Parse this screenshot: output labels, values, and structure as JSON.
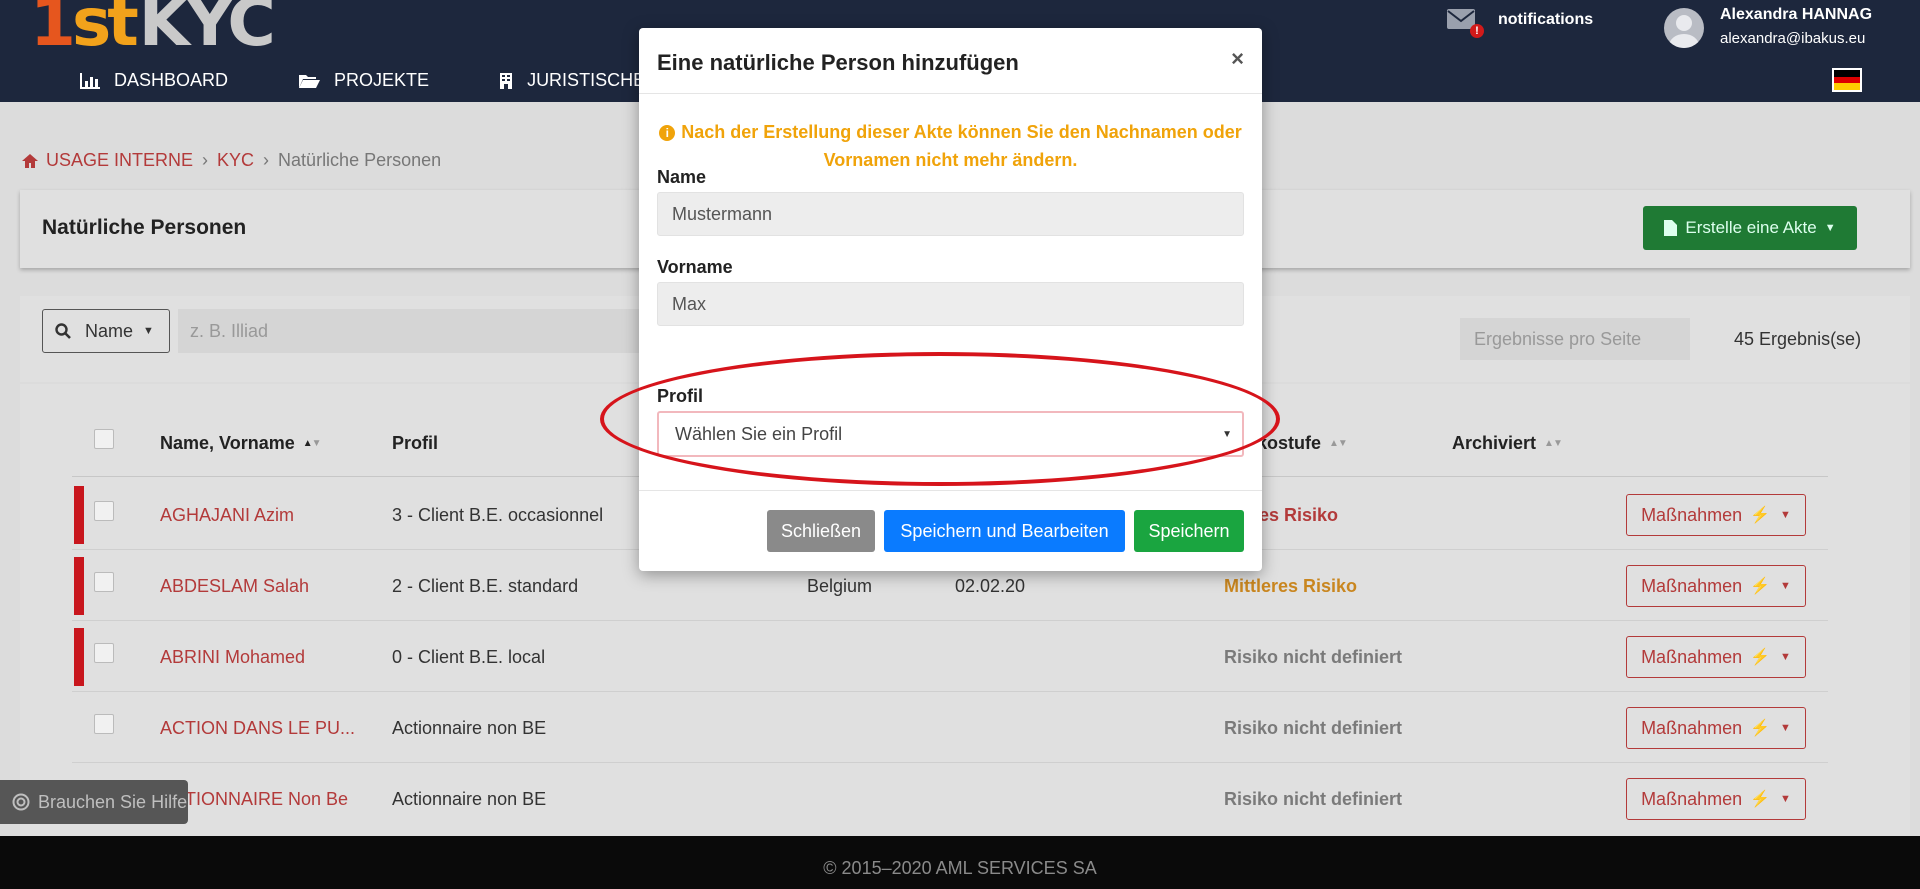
{
  "header": {
    "logo": {
      "num": "1",
      "st": "st",
      "kyc": "KYC"
    },
    "notifications_label": "notifications",
    "notification_badge": "!",
    "user": {
      "name": "Alexandra HANNAG",
      "email": "alexandra@ibakus.eu"
    },
    "nav": [
      {
        "label": "DASHBOARD",
        "icon": "bar-chart-icon"
      },
      {
        "label": "PROJEKTE",
        "icon": "folder-open-icon"
      },
      {
        "label": "JURISTISCHE PERSONEN",
        "icon": "building-icon"
      }
    ],
    "language_flag_colors": [
      "#000000",
      "#dd0000",
      "#ffce00"
    ]
  },
  "breadcrumb": {
    "home": "USAGE INTERNE",
    "kyc": "KYC",
    "current": "Natürliche Personen"
  },
  "page": {
    "title": "Natürliche Personen",
    "create_button": "Erstelle eine Akte"
  },
  "filters": {
    "field_select": "Name",
    "search_placeholder": "z. B. Illiad",
    "per_page_placeholder": "Ergebnisse pro Seite",
    "results_count": "45 Ergebnis(se)"
  },
  "table": {
    "columns": {
      "name": "Name, Vorname",
      "profile": "Profil",
      "risk": "Risikostufe",
      "archived": "Archiviert"
    },
    "rows": [
      {
        "name": "AGHAJANI Azim",
        "profile": "3 - Client B.E. occasionnel",
        "country": "",
        "date": "",
        "risk": "Hohes Risiko",
        "action": "Maßnahmen"
      },
      {
        "name": "ABDESLAM Salah",
        "profile": "2 - Client B.E. standard",
        "country": "Belgium",
        "date": "02.02.20",
        "risk": "Mittleres Risiko",
        "action": "Maßnahmen"
      },
      {
        "name": "ABRINI Mohamed",
        "profile": "0 - Client B.E. local",
        "country": "",
        "date": "",
        "risk": "Risiko nicht definiert",
        "action": "Maßnahmen"
      },
      {
        "name": "ACTION DANS LE PU...",
        "profile": "Actionnaire non BE",
        "country": "",
        "date": "",
        "risk": "Risiko nicht definiert",
        "action": "Maßnahmen"
      },
      {
        "name": "ACTIONNAIRE Non Be",
        "profile": "Actionnaire non BE",
        "country": "",
        "date": "",
        "risk": "Risiko nicht definiert",
        "action": "Maßnahmen"
      }
    ]
  },
  "help_button": "Brauchen Sie Hilfe?",
  "footer": "© 2015–2020 AML SERVICES SA",
  "modal": {
    "title": "Eine natürliche Person hinzufügen",
    "close": "×",
    "warning": "Nach der Erstellung dieser Akte können Sie den Nachnamen oder Vornamen nicht mehr ändern.",
    "fields": {
      "name_label": "Name",
      "name_value": "Mustermann",
      "firstname_label": "Vorname",
      "firstname_value": "Max",
      "profile_label": "Profil",
      "profile_value": "Wählen Sie ein Profil"
    },
    "buttons": {
      "close": "Schließen",
      "save_edit": "Speichern und Bearbeiten",
      "save": "Speichern"
    }
  },
  "colors": {
    "header_bg": "#1d273d",
    "accent_red": "#b33a3a",
    "warning_orange": "#f0a30a",
    "primary_blue": "#0a7bff",
    "success_green": "#1aa540",
    "annotation_red": "#d6141b"
  }
}
